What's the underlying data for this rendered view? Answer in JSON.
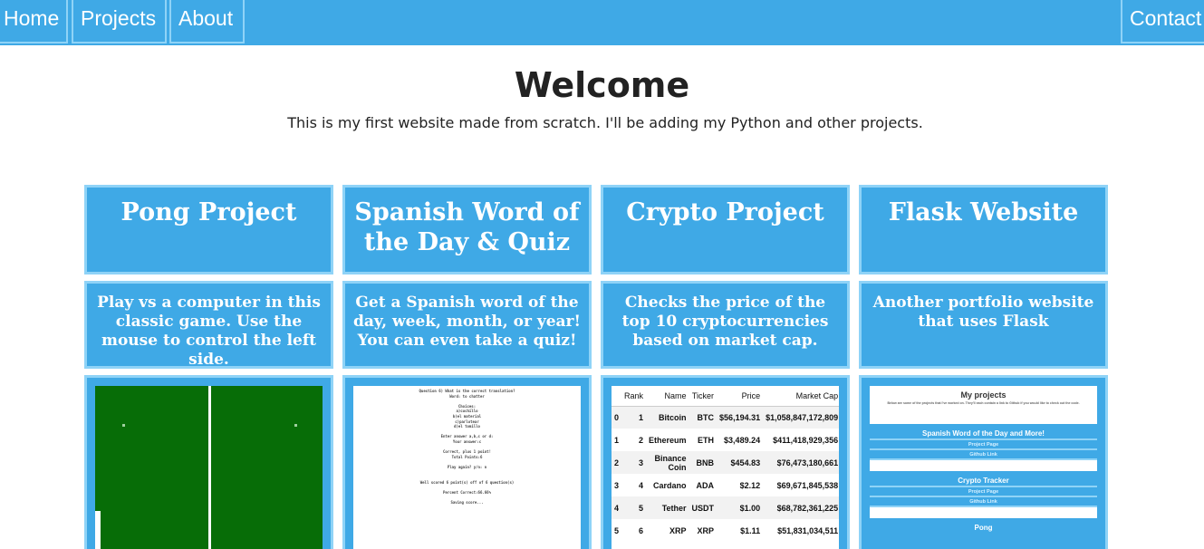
{
  "nav": {
    "home": "Home",
    "projects": "Projects",
    "about": "About",
    "contact": "Contact"
  },
  "welcome": {
    "title": "Welcome",
    "subtitle": "This is my first website made from scratch. I'll be adding my Python and other projects."
  },
  "projects": [
    {
      "title": "Pong Project",
      "description": "Play vs a computer in this classic game. Use the mouse to control the left side."
    },
    {
      "title": "Spanish Word of the Day & Quiz",
      "description": "Get a Spanish word of the day, week, month, or year! You can even take a quiz!"
    },
    {
      "title": "Crypto Project",
      "description": "Checks the price of the top 10 cryptocurrencies based on market cap."
    },
    {
      "title": "Flask Website",
      "description": "Another portfolio website that uses Flask"
    }
  ],
  "spanish_console": [
    "Question 6) What is the correct translation?",
    "Word: to chatter",
    "",
    "Choices:",
    "a)cuchillo",
    "b)el material",
    "c)parlotear",
    "d)el tomillo",
    "",
    "Enter answer a,b,c or d:",
    "Your answer:c",
    "",
    "Correct, plus 1 point!",
    "Total Points:6",
    "",
    "Play again? y/n: n",
    "",
    "",
    "Well scored 6 point(s) off of 6 question(s)",
    "",
    "Percent Correct:66.66%",
    "",
    "Saving score..."
  ],
  "crypto_table": {
    "headers": [
      "",
      "Rank",
      "Name",
      "Ticker",
      "Price",
      "Market Cap"
    ],
    "rows": [
      [
        "0",
        "1",
        "Bitcoin",
        "BTC",
        "$56,194.31",
        "$1,058,847,172,809"
      ],
      [
        "1",
        "2",
        "Ethereum",
        "ETH",
        "$3,489.24",
        "$411,418,929,356"
      ],
      [
        "2",
        "3",
        "Binance Coin",
        "BNB",
        "$454.83",
        "$76,473,180,661"
      ],
      [
        "3",
        "4",
        "Cardano",
        "ADA",
        "$2.12",
        "$69,671,845,538"
      ],
      [
        "4",
        "5",
        "Tether",
        "USDT",
        "$1.00",
        "$68,782,361,225"
      ],
      [
        "5",
        "6",
        "XRP",
        "XRP",
        "$1.11",
        "$51,831,034,511"
      ]
    ]
  },
  "flask_preview": {
    "title": "My projects",
    "subtitle": "Below are some of the projects that I've worked on. They'll each contain a link to Github if you would like to check out the code.",
    "sections": [
      {
        "name": "Spanish Word of the Day and More!",
        "links": [
          "Project Page",
          "Github Link"
        ]
      },
      {
        "name": "Crypto Tracker",
        "links": [
          "Project Page",
          "Github Link"
        ]
      },
      {
        "name": "Pong",
        "links": []
      }
    ]
  },
  "colors": {
    "accent": "#3fa9e6",
    "border": "#8fd3f7",
    "pong_field": "#076d07"
  }
}
